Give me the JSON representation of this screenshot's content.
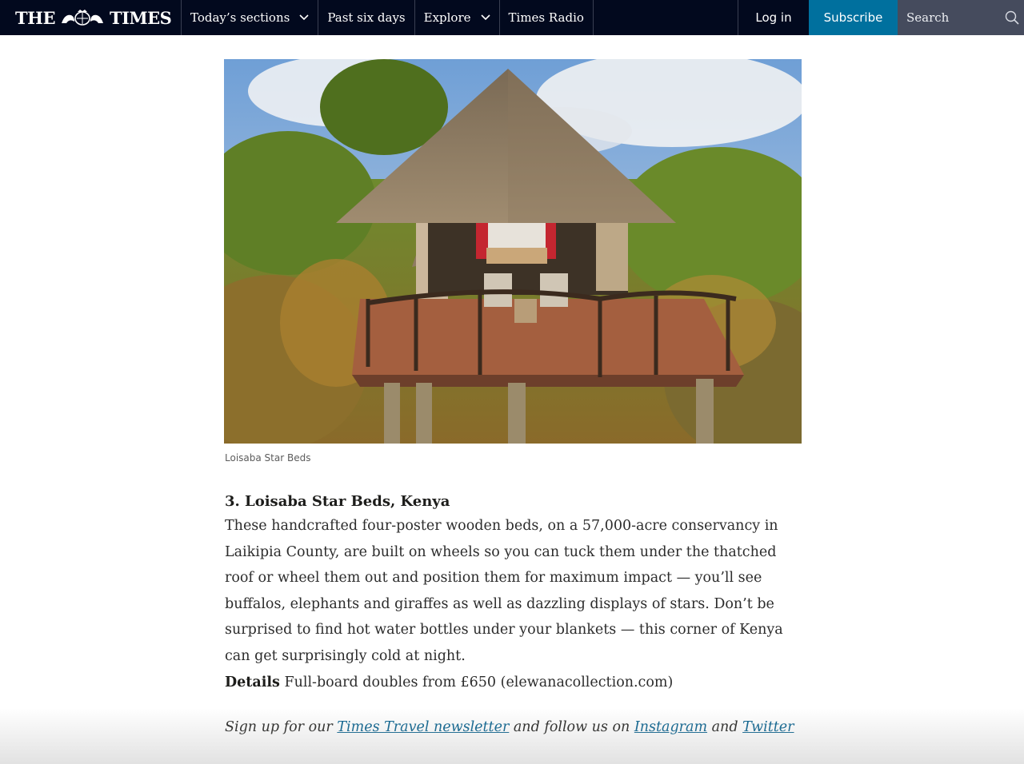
{
  "masthead": {
    "logo_left": "THE",
    "logo_right": "TIMES"
  },
  "nav": {
    "items": [
      {
        "label": "Today’s sections",
        "has_dropdown": true
      },
      {
        "label": "Past six days",
        "has_dropdown": false
      },
      {
        "label": "Explore",
        "has_dropdown": true
      },
      {
        "label": "Times Radio",
        "has_dropdown": false
      }
    ],
    "login_label": "Log in",
    "subscribe_label": "Subscribe",
    "search_placeholder": "Search"
  },
  "article": {
    "image_caption": "Loisaba Star Beds",
    "heading": "3. Loisaba Star Beds, Kenya",
    "body": "These handcrafted four-poster wooden beds, on a 57,000-acre conservancy in Laikipia County, are built on wheels so you can tuck them under the thatched roof or wheel them out and position them for maximum impact — you’ll see buffalos, elephants and giraffes as well as dazzling displays of stars. Don’t be surprised to find hot water bottles under your blankets — this corner of Kenya can get surprisingly cold at night.",
    "details_label": "Details",
    "details_text": " Full-board doubles from £650 (elewanacollection.com)"
  },
  "signup": {
    "prefix": "Sign up for our ",
    "newsletter_link": "Times Travel newsletter",
    "middle": " and follow us on ",
    "instagram_link": "Instagram",
    "and": " and ",
    "twitter_link": "Twitter"
  },
  "colors": {
    "nav_bg": "#02091e",
    "subscribe_bg": "#00709e",
    "search_bg": "#454b5d",
    "link": "#005c8a"
  }
}
